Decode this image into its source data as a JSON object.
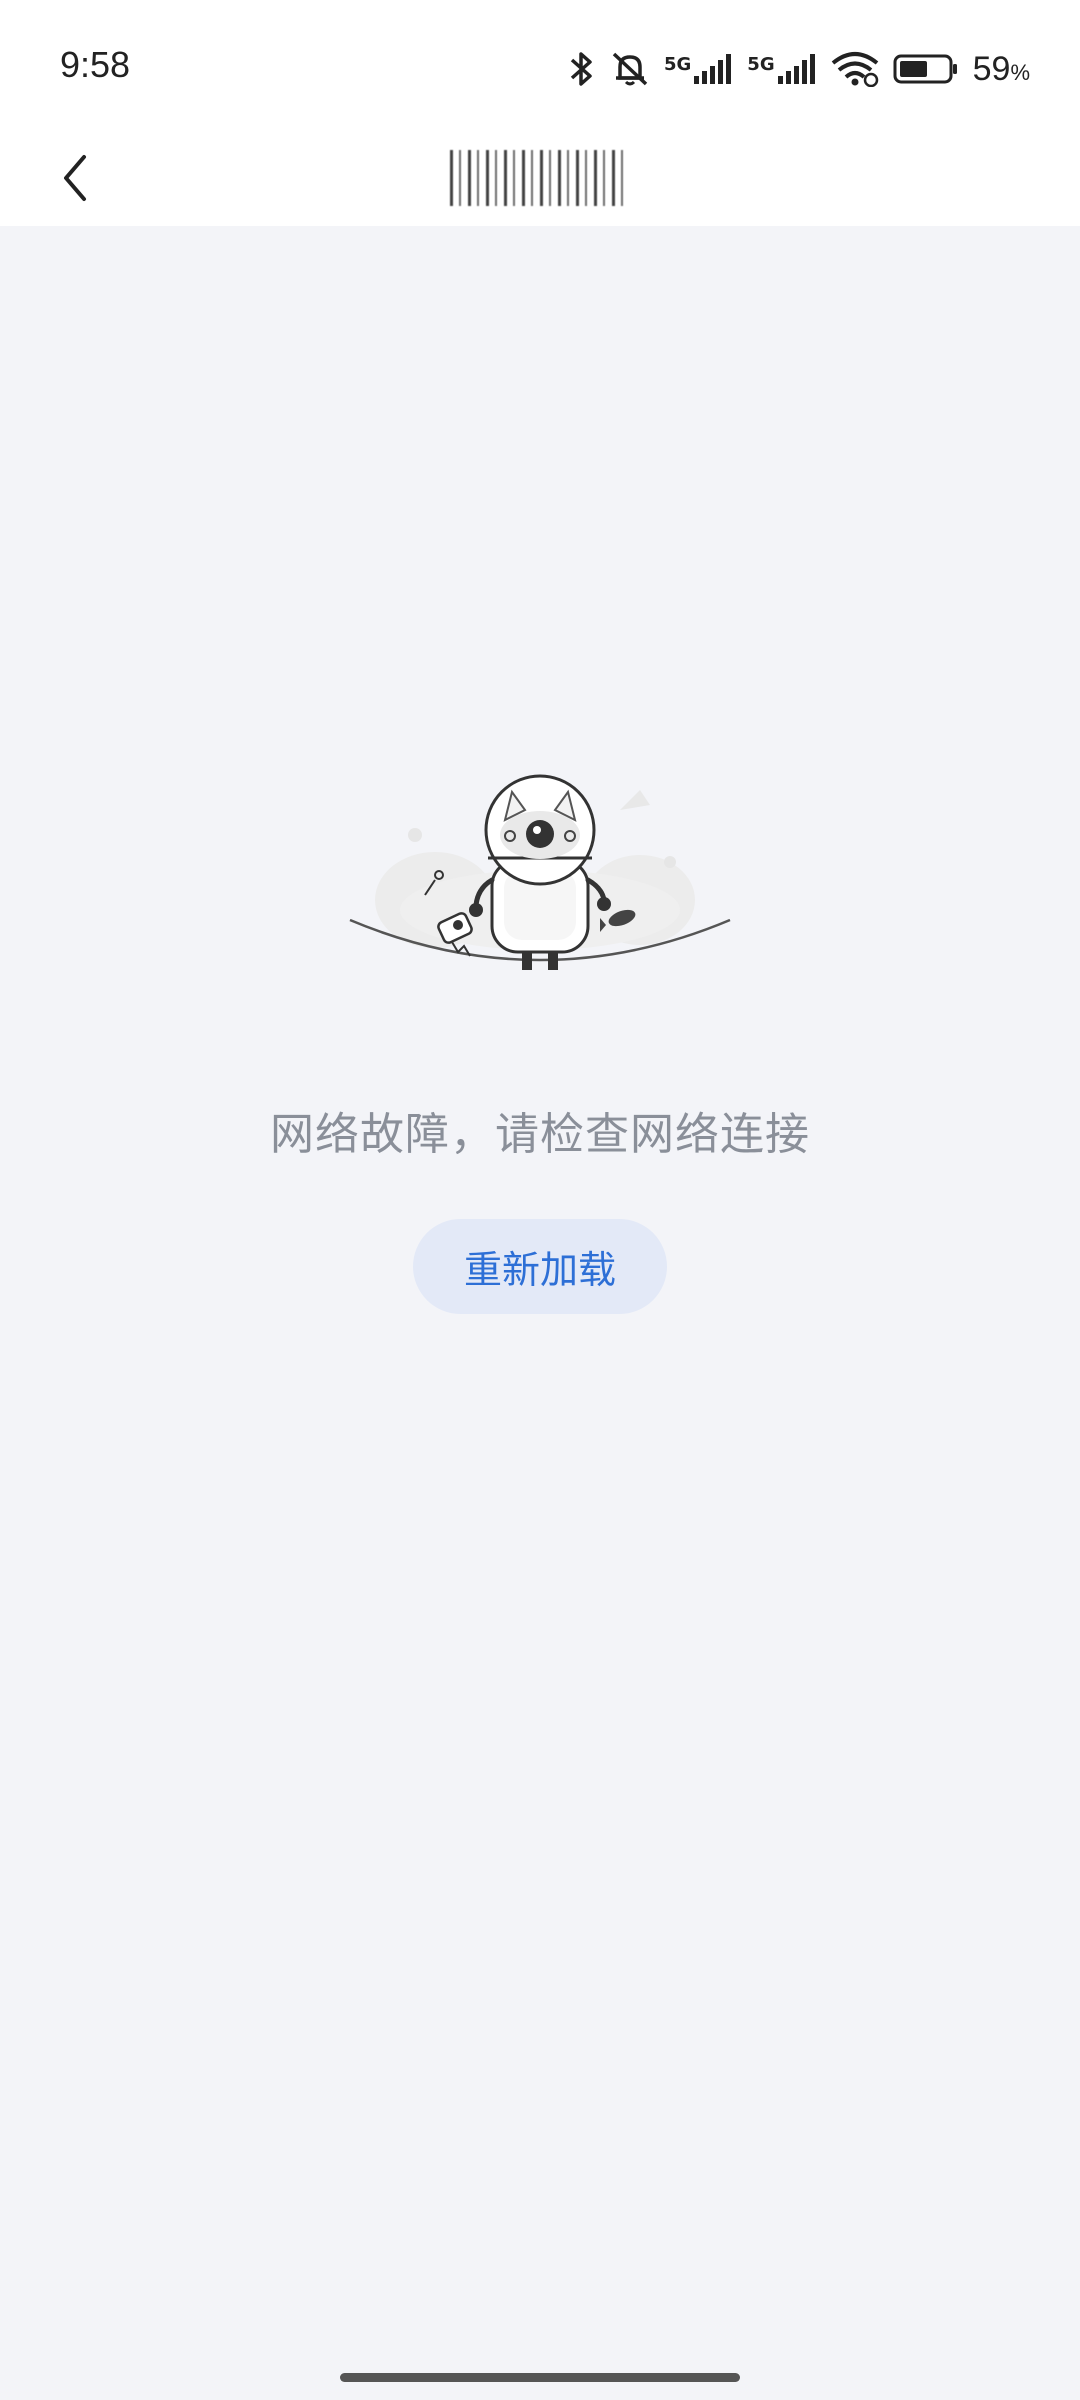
{
  "status_bar": {
    "time": "9:58",
    "network_label_1": "5G",
    "network_label_2": "5G",
    "battery_percent": "59",
    "battery_unit": "%",
    "battery_level": 0.59,
    "icons": [
      "bluetooth-icon",
      "mute-icon",
      "signal-5g-icon",
      "signal-5g-icon",
      "wifi-icon",
      "battery-icon"
    ]
  },
  "nav": {
    "back_icon": "chevron-left-icon"
  },
  "error": {
    "message": "网络故障，请检查网络连接",
    "reload_label": "重新加载"
  },
  "colors": {
    "background": "#f3f4f8",
    "accent": "#2d6fd6",
    "button_bg": "#e3e9f7",
    "message_text": "#8a8f99"
  }
}
